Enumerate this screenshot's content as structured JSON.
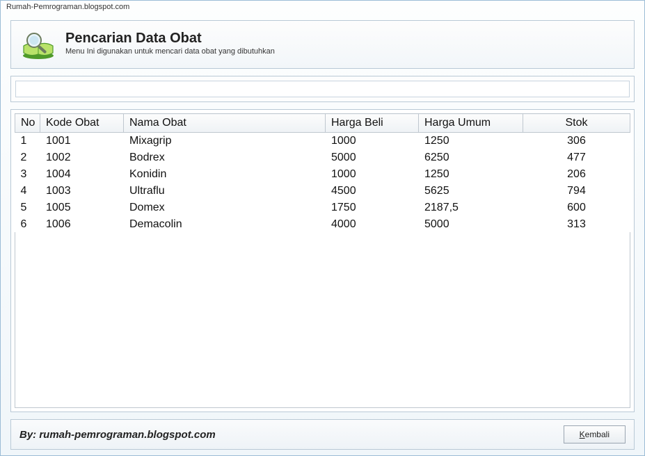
{
  "window": {
    "title": "Rumah-Pemrograman.blogspot.com"
  },
  "header": {
    "title": "Pencarian Data Obat",
    "subtitle": "Menu Ini digunakan untuk mencari data obat yang dibutuhkan"
  },
  "search": {
    "value": ""
  },
  "table": {
    "columns": {
      "no": "No",
      "kode": "Kode Obat",
      "nama": "Nama Obat",
      "beli": "Harga Beli",
      "umum": "Harga Umum",
      "stok": "Stok"
    },
    "rows": [
      {
        "no": "1",
        "kode": "1001",
        "nama": "Mixagrip",
        "beli": "1000",
        "umum": "1250",
        "stok": "306"
      },
      {
        "no": "2",
        "kode": "1002",
        "nama": "Bodrex",
        "beli": "5000",
        "umum": "6250",
        "stok": "477"
      },
      {
        "no": "3",
        "kode": "1004",
        "nama": "Konidin",
        "beli": "1000",
        "umum": "1250",
        "stok": "206"
      },
      {
        "no": "4",
        "kode": "1003",
        "nama": "Ultraflu",
        "beli": "4500",
        "umum": "5625",
        "stok": "794"
      },
      {
        "no": "5",
        "kode": "1005",
        "nama": "Domex",
        "beli": "1750",
        "umum": "2187,5",
        "stok": "600"
      },
      {
        "no": "6",
        "kode": "1006",
        "nama": "Demacolin",
        "beli": "4000",
        "umum": "5000",
        "stok": "313"
      }
    ]
  },
  "footer": {
    "credit": "By: rumah-pemrograman.blogspot.com",
    "back_label": "Kembali",
    "back_accelerator": "K"
  }
}
